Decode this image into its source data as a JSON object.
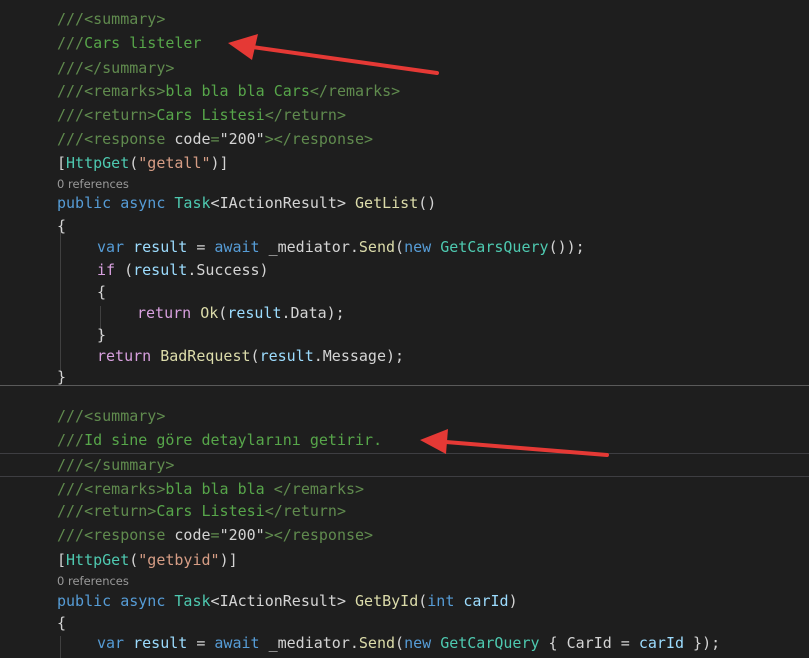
{
  "colors": {
    "background": "#1e1e1e",
    "comment": "#57a64a",
    "xml_tag": "#608b4e",
    "attribute": "#d4d4d4",
    "string": "#d69d85",
    "keyword": "#569cd6",
    "type": "#4ec9b0",
    "method": "#dcdcaa",
    "variable": "#9cdcfe",
    "control": "#d8a0df",
    "plain": "#d4d4d4",
    "codelens": "#999999",
    "annotation_arrow": "#e53935"
  },
  "code_lines": [
    {
      "kind": "code",
      "tokens": [
        {
          "t": "///",
          "c": "xml_tag"
        },
        {
          "t": "<summary>",
          "c": "xml_tag"
        }
      ]
    },
    {
      "kind": "code",
      "tokens": [
        {
          "t": "///",
          "c": "xml_tag"
        },
        {
          "t": "Cars listeler",
          "c": "comment"
        }
      ]
    },
    {
      "kind": "code",
      "tokens": [
        {
          "t": "///",
          "c": "xml_tag"
        },
        {
          "t": "</summary>",
          "c": "xml_tag"
        }
      ]
    },
    {
      "kind": "code",
      "tokens": [
        {
          "t": "///",
          "c": "xml_tag"
        },
        {
          "t": "<remarks>",
          "c": "xml_tag"
        },
        {
          "t": "bla bla bla Cars",
          "c": "comment"
        },
        {
          "t": "</remarks>",
          "c": "xml_tag"
        }
      ]
    },
    {
      "kind": "code",
      "tokens": [
        {
          "t": "///",
          "c": "xml_tag"
        },
        {
          "t": "<return>",
          "c": "xml_tag"
        },
        {
          "t": "Cars Listesi",
          "c": "comment"
        },
        {
          "t": "</return>",
          "c": "xml_tag"
        }
      ]
    },
    {
      "kind": "code",
      "tokens": [
        {
          "t": "///",
          "c": "xml_tag"
        },
        {
          "t": "<response ",
          "c": "xml_tag"
        },
        {
          "t": "code",
          "c": "attribute"
        },
        {
          "t": "=",
          "c": "xml_tag"
        },
        {
          "t": "\"200\"",
          "c": "attribute"
        },
        {
          "t": "></response>",
          "c": "xml_tag"
        }
      ]
    },
    {
      "kind": "code",
      "tokens": [
        {
          "t": "[",
          "c": "plain"
        },
        {
          "t": "HttpGet",
          "c": "type"
        },
        {
          "t": "(",
          "c": "plain"
        },
        {
          "t": "\"getall\"",
          "c": "string"
        },
        {
          "t": ")]",
          "c": "plain"
        }
      ]
    },
    {
      "kind": "lens",
      "tokens": [
        {
          "t": "0 references",
          "c": "codelens"
        }
      ]
    },
    {
      "kind": "code",
      "tokens": [
        {
          "t": "public",
          "c": "keyword"
        },
        {
          "t": " ",
          "c": "plain"
        },
        {
          "t": "async",
          "c": "keyword"
        },
        {
          "t": " ",
          "c": "plain"
        },
        {
          "t": "Task",
          "c": "type"
        },
        {
          "t": "<",
          "c": "plain"
        },
        {
          "t": "IActionResult",
          "c": "plain"
        },
        {
          "t": "> ",
          "c": "plain"
        },
        {
          "t": "GetList",
          "c": "method"
        },
        {
          "t": "()",
          "c": "plain"
        }
      ]
    },
    {
      "kind": "code",
      "tokens": [
        {
          "t": "{",
          "c": "plain"
        }
      ]
    },
    {
      "kind": "code",
      "tokens": [
        {
          "t": "var",
          "c": "keyword"
        },
        {
          "t": " ",
          "c": "plain"
        },
        {
          "t": "result",
          "c": "variable"
        },
        {
          "t": " = ",
          "c": "plain"
        },
        {
          "t": "await",
          "c": "keyword"
        },
        {
          "t": " _mediator.",
          "c": "plain"
        },
        {
          "t": "Send",
          "c": "method"
        },
        {
          "t": "(",
          "c": "plain"
        },
        {
          "t": "new",
          "c": "keyword"
        },
        {
          "t": " ",
          "c": "plain"
        },
        {
          "t": "GetCarsQuery",
          "c": "type"
        },
        {
          "t": "());",
          "c": "plain"
        }
      ]
    },
    {
      "kind": "code",
      "tokens": [
        {
          "t": "if",
          "c": "control"
        },
        {
          "t": " (",
          "c": "plain"
        },
        {
          "t": "result",
          "c": "variable"
        },
        {
          "t": ".Success)",
          "c": "plain"
        }
      ]
    },
    {
      "kind": "code",
      "tokens": [
        {
          "t": "{",
          "c": "plain"
        }
      ]
    },
    {
      "kind": "code",
      "tokens": [
        {
          "t": "return",
          "c": "control"
        },
        {
          "t": " ",
          "c": "plain"
        },
        {
          "t": "Ok",
          "c": "method"
        },
        {
          "t": "(",
          "c": "plain"
        },
        {
          "t": "result",
          "c": "variable"
        },
        {
          "t": ".Data);",
          "c": "plain"
        }
      ]
    },
    {
      "kind": "code",
      "tokens": [
        {
          "t": "}",
          "c": "plain"
        }
      ]
    },
    {
      "kind": "code",
      "tokens": [
        {
          "t": "return",
          "c": "control"
        },
        {
          "t": " ",
          "c": "plain"
        },
        {
          "t": "BadRequest",
          "c": "method"
        },
        {
          "t": "(",
          "c": "plain"
        },
        {
          "t": "result",
          "c": "variable"
        },
        {
          "t": ".Message);",
          "c": "plain"
        }
      ]
    },
    {
      "kind": "code",
      "tokens": [
        {
          "t": "}",
          "c": "plain"
        }
      ]
    },
    {
      "kind": "blank",
      "tokens": []
    },
    {
      "kind": "code",
      "tokens": [
        {
          "t": "///",
          "c": "xml_tag"
        },
        {
          "t": "<summary>",
          "c": "xml_tag"
        }
      ]
    },
    {
      "kind": "code",
      "tokens": [
        {
          "t": "///",
          "c": "xml_tag"
        },
        {
          "t": "Id sine göre detaylarını getirir.",
          "c": "comment"
        }
      ]
    },
    {
      "kind": "code",
      "tokens": [
        {
          "t": "///",
          "c": "xml_tag"
        },
        {
          "t": "</summary>",
          "c": "xml_tag"
        }
      ]
    },
    {
      "kind": "code",
      "tokens": [
        {
          "t": "///",
          "c": "xml_tag"
        },
        {
          "t": "<remarks>",
          "c": "xml_tag"
        },
        {
          "t": "bla bla bla ",
          "c": "comment"
        },
        {
          "t": "</remarks>",
          "c": "xml_tag"
        }
      ]
    },
    {
      "kind": "code",
      "tokens": [
        {
          "t": "///",
          "c": "xml_tag"
        },
        {
          "t": "<return>",
          "c": "xml_tag"
        },
        {
          "t": "Cars Listesi",
          "c": "comment"
        },
        {
          "t": "</return>",
          "c": "xml_tag"
        }
      ]
    },
    {
      "kind": "code",
      "tokens": [
        {
          "t": "///",
          "c": "xml_tag"
        },
        {
          "t": "<response ",
          "c": "xml_tag"
        },
        {
          "t": "code",
          "c": "attribute"
        },
        {
          "t": "=",
          "c": "xml_tag"
        },
        {
          "t": "\"200\"",
          "c": "attribute"
        },
        {
          "t": "></response>",
          "c": "xml_tag"
        }
      ]
    },
    {
      "kind": "code",
      "tokens": [
        {
          "t": "[",
          "c": "plain"
        },
        {
          "t": "HttpGet",
          "c": "type"
        },
        {
          "t": "(",
          "c": "plain"
        },
        {
          "t": "\"getbyid\"",
          "c": "string"
        },
        {
          "t": ")]",
          "c": "plain"
        }
      ]
    },
    {
      "kind": "lens",
      "tokens": [
        {
          "t": "0 references",
          "c": "codelens"
        }
      ]
    },
    {
      "kind": "code",
      "tokens": [
        {
          "t": "public",
          "c": "keyword"
        },
        {
          "t": " ",
          "c": "plain"
        },
        {
          "t": "async",
          "c": "keyword"
        },
        {
          "t": " ",
          "c": "plain"
        },
        {
          "t": "Task",
          "c": "type"
        },
        {
          "t": "<",
          "c": "plain"
        },
        {
          "t": "IActionResult",
          "c": "plain"
        },
        {
          "t": "> ",
          "c": "plain"
        },
        {
          "t": "GetById",
          "c": "method"
        },
        {
          "t": "(",
          "c": "plain"
        },
        {
          "t": "int",
          "c": "keyword"
        },
        {
          "t": " ",
          "c": "plain"
        },
        {
          "t": "carId",
          "c": "variable"
        },
        {
          "t": ")",
          "c": "plain"
        }
      ]
    },
    {
      "kind": "code",
      "tokens": [
        {
          "t": "{",
          "c": "plain"
        }
      ]
    },
    {
      "kind": "code",
      "tokens": [
        {
          "t": "var",
          "c": "keyword"
        },
        {
          "t": " ",
          "c": "plain"
        },
        {
          "t": "result",
          "c": "variable"
        },
        {
          "t": " = ",
          "c": "plain"
        },
        {
          "t": "await",
          "c": "keyword"
        },
        {
          "t": " _mediator.",
          "c": "plain"
        },
        {
          "t": "Send",
          "c": "method"
        },
        {
          "t": "(",
          "c": "plain"
        },
        {
          "t": "new",
          "c": "keyword"
        },
        {
          "t": " ",
          "c": "plain"
        },
        {
          "t": "GetCarQuery",
          "c": "type"
        },
        {
          "t": " { ",
          "c": "plain"
        },
        {
          "t": "CarId",
          "c": "plain"
        },
        {
          "t": " = ",
          "c": "plain"
        },
        {
          "t": "carId",
          "c": "variable"
        },
        {
          "t": " });",
          "c": "plain"
        }
      ]
    }
  ]
}
